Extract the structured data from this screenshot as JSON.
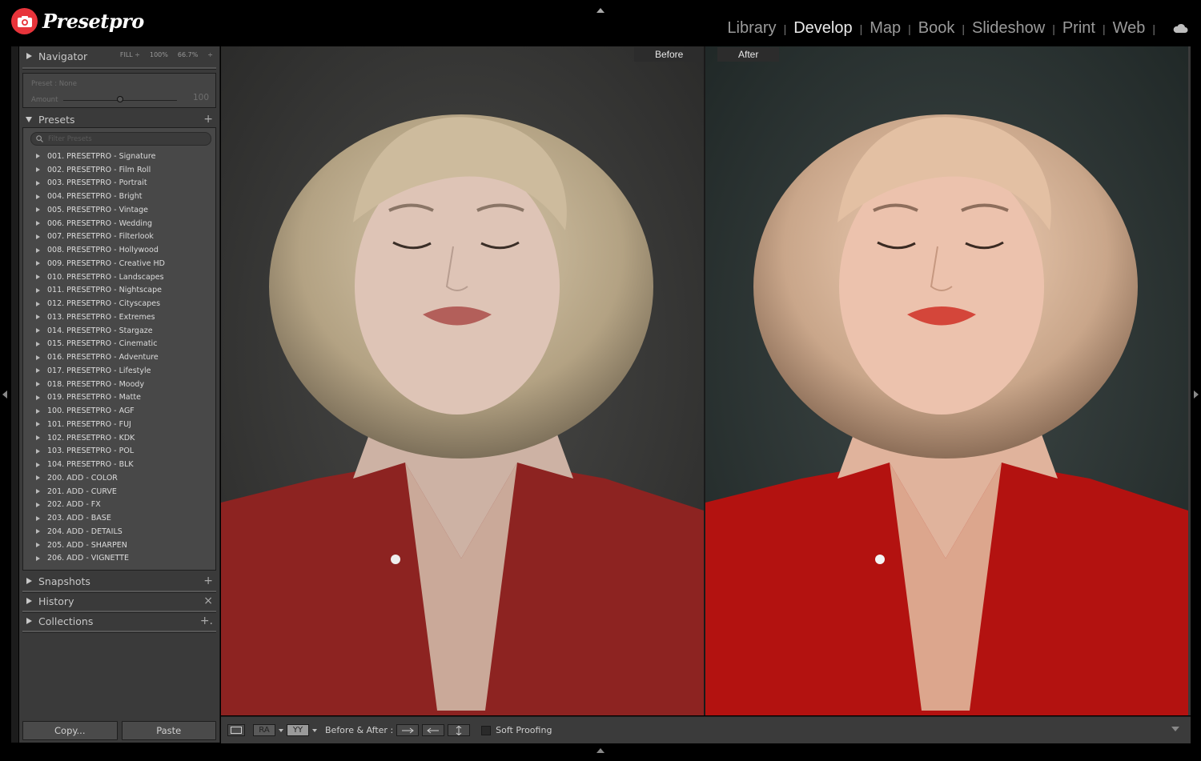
{
  "app": {
    "brand": "Presetpro",
    "modules": [
      {
        "label": "Library",
        "active": false
      },
      {
        "label": "Develop",
        "active": true
      },
      {
        "label": "Map",
        "active": false
      },
      {
        "label": "Book",
        "active": false
      },
      {
        "label": "Slideshow",
        "active": false
      },
      {
        "label": "Print",
        "active": false
      },
      {
        "label": "Web",
        "active": false
      }
    ],
    "separator": "|",
    "colors": {
      "accent": "#e8343b",
      "background": "#000000",
      "panel": "#3a3a3a"
    }
  },
  "left_panel": {
    "navigator": {
      "title": "Navigator",
      "fill": "FILL ÷",
      "zoom1": "100%",
      "zoom2": "66.7%",
      "zoom_arrow": "÷"
    },
    "preset_amount": {
      "preset_text": "Preset : None",
      "amount_label": "Amount",
      "amount_value": "100"
    },
    "presets": {
      "title": "Presets",
      "add_icon": "+",
      "filter_placeholder": "Filter Presets",
      "items": [
        "001. PRESETPRO - Signature",
        "002. PRESETPRO - Film Roll",
        "003. PRESETPRO - Portrait",
        "004. PRESETPRO - Bright",
        "005. PRESETPRO - Vintage",
        "006. PRESETPRO - Wedding",
        "007. PRESETPRO - Filterlook",
        "008. PRESETPRO - Hollywood",
        "009. PRESETPRO - Creative HD",
        "010. PRESETPRO - Landscapes",
        "011. PRESETPRO - Nightscape",
        "012. PRESETPRO - Cityscapes",
        "013. PRESETPRO - Extremes",
        "014. PRESETPRO - Stargaze",
        "015. PRESETPRO - Cinematic",
        "016. PRESETPRO - Adventure",
        "017. PRESETPRO - Lifestyle",
        "018. PRESETPRO - Moody",
        "019. PRESETPRO - Matte",
        "100. PRESETPRO - AGF",
        "101. PRESETPRO - FUJ",
        "102. PRESETPRO - KDK",
        "103. PRESETPRO - POL",
        "104. PRESETPRO - BLK",
        "200. ADD - COLOR",
        "201. ADD - CURVE",
        "202. ADD - FX",
        "203. ADD - BASE",
        "204. ADD - DETAILS",
        "205. ADD - SHARPEN",
        "206. ADD - VIGNETTE"
      ]
    },
    "snapshots": {
      "title": "Snapshots",
      "action": "+"
    },
    "history": {
      "title": "History",
      "action": "×"
    },
    "collections": {
      "title": "Collections",
      "action": "+."
    },
    "buttons": {
      "copy": "Copy...",
      "paste": "Paste"
    }
  },
  "main": {
    "label_before": "Before",
    "label_after": "After"
  },
  "toolbar": {
    "before_after_label": "Before & After :",
    "view_ra": "RA",
    "view_yy": "YY",
    "soft_proofing": "Soft Proofing"
  }
}
